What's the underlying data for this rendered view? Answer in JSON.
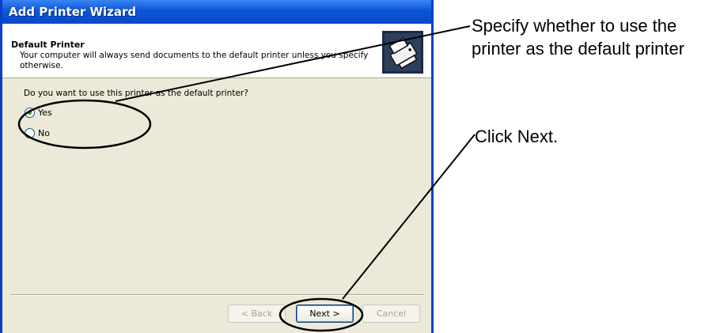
{
  "window": {
    "title": "Add Printer Wizard"
  },
  "header": {
    "title": "Default Printer",
    "subtitle": "Your computer will always send documents to the default printer unless you specify otherwise.",
    "icon": "printer-icon"
  },
  "body": {
    "question": "Do you want to use this printer as the default printer?",
    "options": [
      {
        "label": "Yes",
        "selected": true
      },
      {
        "label": "No",
        "selected": false
      }
    ]
  },
  "buttons": {
    "back": "< Back",
    "next": "Next >",
    "cancel": "Cancel"
  },
  "annotations": {
    "default_printer_note": "Specify whether to use the printer as the default printer",
    "next_note": "Click Next."
  },
  "colors": {
    "titlebar": "#0a49c6",
    "dialog_bg": "#ece9d8",
    "radio_selected": "#21a121",
    "annotation": "#000000"
  }
}
